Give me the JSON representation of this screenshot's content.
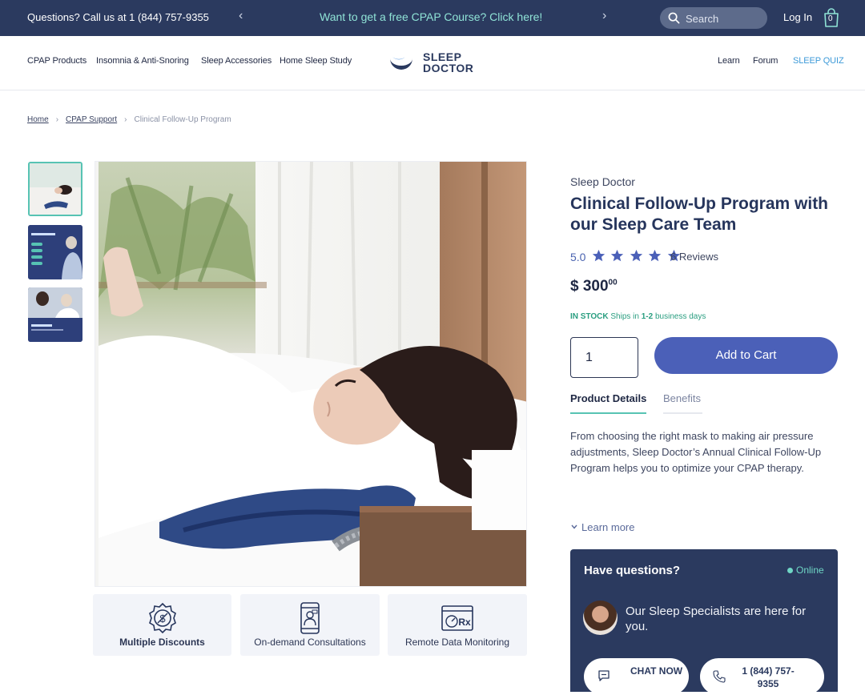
{
  "topbar": {
    "phone_text": "Questions? Call us at 1 (844) 757-9355",
    "promo_text": "Want to get a free CPAP Course? Click here!",
    "prev_arrow": "‹",
    "next_arrow": "›",
    "search_placeholder": "Search",
    "login_label": "Log In",
    "cart_count": "0"
  },
  "nav": {
    "left_items": [
      "CPAP Products",
      "Insomnia & Anti-Snoring",
      "Sleep Accessories",
      "Home Sleep Study"
    ],
    "logo_line1": "SLEEP",
    "logo_line2": "DOCTOR",
    "right_items": [
      "Learn",
      "Forum",
      "SLEEP QUIZ"
    ]
  },
  "breadcrumb": {
    "items": [
      "Home",
      "CPAP Support"
    ],
    "current": "Clinical Follow-Up Program",
    "separator": "›"
  },
  "features": [
    {
      "label": "Multiple Discounts",
      "icon": "discount-badge-icon"
    },
    {
      "label": "On-demand Consultations",
      "icon": "phone-doctor-icon"
    },
    {
      "label": "Remote Data Monitoring",
      "icon": "rx-monitor-icon"
    }
  ],
  "product": {
    "brand": "Sleep Doctor",
    "title": "Clinical Follow-Up Program with our Sleep Care Team",
    "rating_value": "5.0",
    "rating_stars": 5,
    "reviews_label": "6 Reviews",
    "price_main": "$ 300",
    "price_cents": "00",
    "stock_status": "IN STOCK",
    "ships_prefix": "Ships in",
    "ships_days": "1-2",
    "ships_suffix": "business days",
    "quantity": "1",
    "add_to_cart_label": "Add to Cart",
    "tabs": [
      "Product Details",
      "Benefits"
    ],
    "description": "From choosing the right mask to making air pressure adjustments, Sleep Doctor’s Annual Clinical Follow-Up Program helps you to optimize your CPAP therapy.",
    "learn_more_label": "Learn more"
  },
  "chat": {
    "heading": "Have questions?",
    "status": "Online",
    "specialists_text": "Our Sleep Specialists are here for you.",
    "chat_button_label": "CHAT NOW",
    "call_button_label": "1 (844) 757-9355"
  },
  "colors": {
    "navy": "#2b3a5f",
    "teal": "#57c3b3",
    "accent_blue": "#4b60b8",
    "stock_green": "#2a9e80"
  }
}
